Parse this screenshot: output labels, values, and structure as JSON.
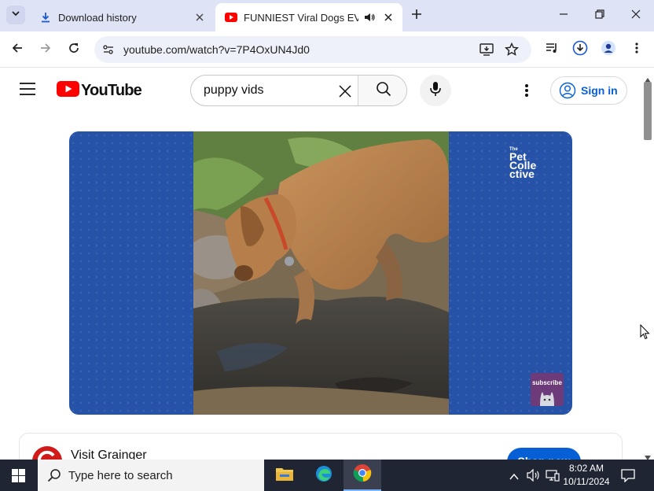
{
  "browser": {
    "tabs": [
      {
        "label": "Download history",
        "icon": "download-icon",
        "active": false
      },
      {
        "label": "FUNNIEST Viral Dogs EVER",
        "icon": "youtube-favicon",
        "active": true,
        "audio": true
      }
    ],
    "address": "youtube.com/watch?v=7P4OxUN4Jd0"
  },
  "youtube": {
    "logo_text": "YouTube",
    "search_query": "puppy vids",
    "signin_label": "Sign in",
    "video": {
      "logo_lines": [
        "The",
        "Pet",
        "Colle",
        "ctive"
      ],
      "subscribe_label": "subscribe"
    },
    "ad": {
      "title": "Visit Grainger",
      "cta": "Shop now"
    }
  },
  "taskbar": {
    "search_placeholder": "Type here to search",
    "time": "8:02 AM",
    "date": "10/11/2024"
  },
  "colors": {
    "tabstrip": "#dee3f6",
    "youtube_red": "#ff0000",
    "link_blue": "#065fd4",
    "video_bg": "#2653a8",
    "taskbar": "#1f2532"
  }
}
